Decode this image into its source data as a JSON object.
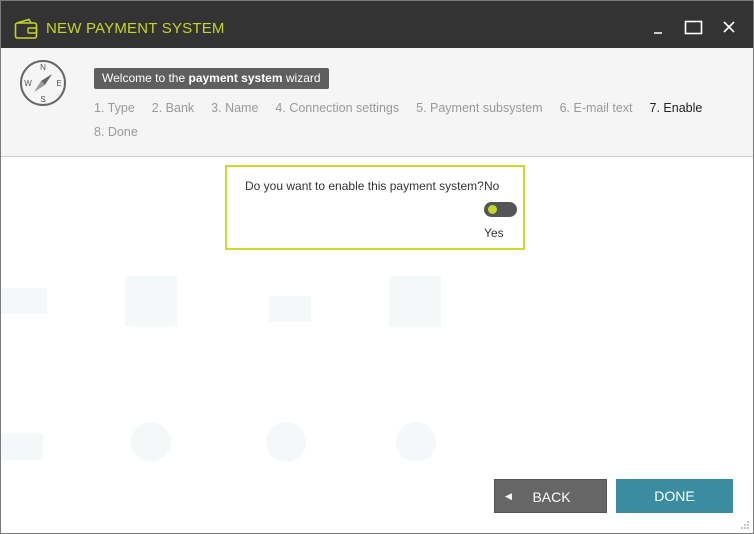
{
  "window": {
    "title": "NEW PAYMENT SYSTEM",
    "icons": {
      "app": "wallet-icon",
      "minimize": "minimize-icon",
      "maximize": "maximize-icon",
      "close": "close-icon"
    }
  },
  "header": {
    "welcome_prefix": "Welcome to the ",
    "welcome_bold": "payment system",
    "welcome_suffix": " wizard",
    "compass_labels": {
      "n": "N",
      "e": "E",
      "s": "S",
      "w": "W"
    },
    "steps": [
      {
        "label": "1. Type",
        "active": false
      },
      {
        "label": "2. Bank",
        "active": false
      },
      {
        "label": "3. Name",
        "active": false
      },
      {
        "label": "4. Connection settings",
        "active": false
      },
      {
        "label": "5. Payment subsystem",
        "active": false
      },
      {
        "label": "6. E-mail text",
        "active": false
      },
      {
        "label": "7. Enable",
        "active": true
      },
      {
        "label": "8. Done",
        "active": false
      }
    ]
  },
  "form": {
    "question": "Do you want to enable this payment system?",
    "option_no": "No",
    "option_yes": "Yes",
    "toggle_state": "No"
  },
  "footer": {
    "back_label": "BACK",
    "done_label": "DONE"
  },
  "colors": {
    "titlebar": "#333333",
    "accent": "#c4d62a",
    "done_button": "#3a8ca1",
    "back_button": "#666666"
  }
}
